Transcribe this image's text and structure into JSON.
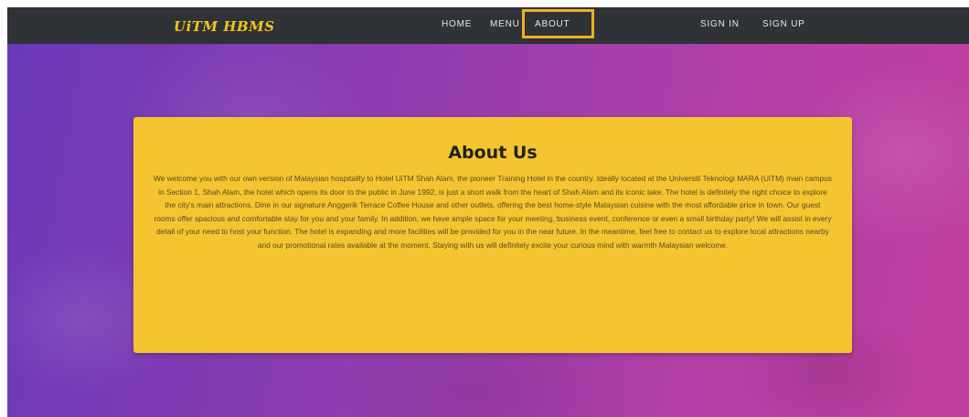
{
  "nav": {
    "brand": "UiTM HBMS",
    "links": {
      "home": "HOME",
      "menu": "MENU",
      "about": "ABOUT",
      "sign_in": "SIGN IN",
      "sign_up": "SIGN UP"
    }
  },
  "about": {
    "title": "About Us",
    "body": "We welcome you with our own version of Malaysian hospitality to Hotel UiTM Shah Alam, the pioneer Training Hotel in the country. Ideally located at the Universiti Teknologi MARA (UiTM) main campus in Section 1, Shah Alam, the hotel which opens its door to the public in June 1992, is just a short walk from the heart of Shah Alam and its iconic lake. The hotel is definitely the right choice to explore the city's main attractions. Dine in our signature Anggerik Terrace Coffee House and other outlets, offering the best home-style Malaysian cuisine with the most affordable price in town. Our guest rooms offer spacious and comfortable stay for you and your family. In addition, we have ample space for your meeting, business event, conference or even a small birthday party! We will assist in every detail of your need to host your function. The hotel is expanding and more facilities will be provided for you in the near future. In the meantime, feel free to contact us to explore local attractions nearby and our promotional rates available at the moment. Staying with us will definitely excite your curious mind with warmth Malaysian welcome."
  },
  "colors": {
    "nav_bg": "#2f3237",
    "brand": "#f5c518",
    "highlight": "#f2b01e",
    "card_bg": "#f4c531",
    "hero_start": "#6a39b8",
    "hero_end": "#c13f9f"
  }
}
